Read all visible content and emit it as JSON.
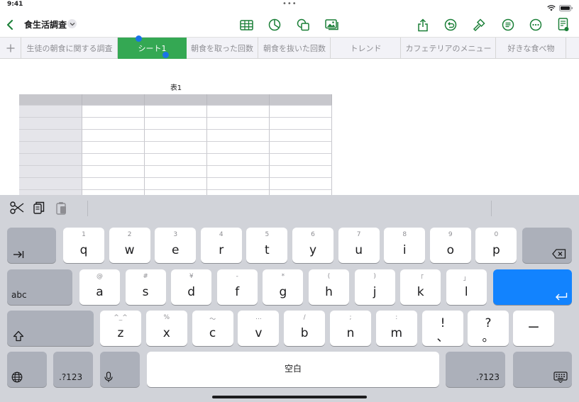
{
  "status": {
    "time": "9:41"
  },
  "toolbar": {
    "back_icon": "chevron-left-icon",
    "title": "食生活調査",
    "title_menu_icon": "chevron-down-icon"
  },
  "tabs": {
    "add_icon": "plus-icon",
    "items": [
      {
        "label": "生徒の朝食に関する調査",
        "active": false
      },
      {
        "label": "シート1",
        "active": true
      },
      {
        "label": "朝食を取った回数",
        "active": false
      },
      {
        "label": "朝食を抜いた回数",
        "active": false
      },
      {
        "label": "トレンド",
        "active": false
      },
      {
        "label": "カフェテリアのメニュー",
        "active": false
      },
      {
        "label": "好きな食べ物",
        "active": false
      }
    ]
  },
  "canvas": {
    "table_title": "表1"
  },
  "colors": {
    "accent": "#34a853",
    "tint": "#1a7f37",
    "keyboard_return": "#1283fe"
  },
  "keyboard": {
    "row1": [
      {
        "sub": "1",
        "main": "q"
      },
      {
        "sub": "2",
        "main": "w"
      },
      {
        "sub": "3",
        "main": "e"
      },
      {
        "sub": "4",
        "main": "r"
      },
      {
        "sub": "5",
        "main": "t"
      },
      {
        "sub": "6",
        "main": "y"
      },
      {
        "sub": "7",
        "main": "u"
      },
      {
        "sub": "8",
        "main": "i"
      },
      {
        "sub": "9",
        "main": "o"
      },
      {
        "sub": "0",
        "main": "p"
      }
    ],
    "row2": [
      {
        "sub": "@",
        "main": "a"
      },
      {
        "sub": "#",
        "main": "s"
      },
      {
        "sub": "¥",
        "main": "d"
      },
      {
        "sub": "-",
        "main": "f"
      },
      {
        "sub": "*",
        "main": "g"
      },
      {
        "sub": "(",
        "main": "h"
      },
      {
        "sub": ")",
        "main": "j"
      },
      {
        "sub": "「",
        "main": "k"
      },
      {
        "sub": "」",
        "main": "l"
      }
    ],
    "row3": [
      {
        "sub": "^_^",
        "main": "z"
      },
      {
        "sub": "%",
        "main": "x"
      },
      {
        "sub": "〜",
        "main": "c"
      },
      {
        "sub": "...",
        "main": "v"
      },
      {
        "sub": "/",
        "main": "b"
      },
      {
        "sub": ";",
        "main": "n"
      },
      {
        "sub": ":",
        "main": "m"
      }
    ],
    "exclaim_key": {
      "top": "!",
      "bottom": "、"
    },
    "question_key": {
      "top": "?",
      "bottom": "。"
    },
    "dash_key": "ー",
    "abc_label": "abc",
    "space_label": "空白",
    "numbers_label": ".?123"
  }
}
